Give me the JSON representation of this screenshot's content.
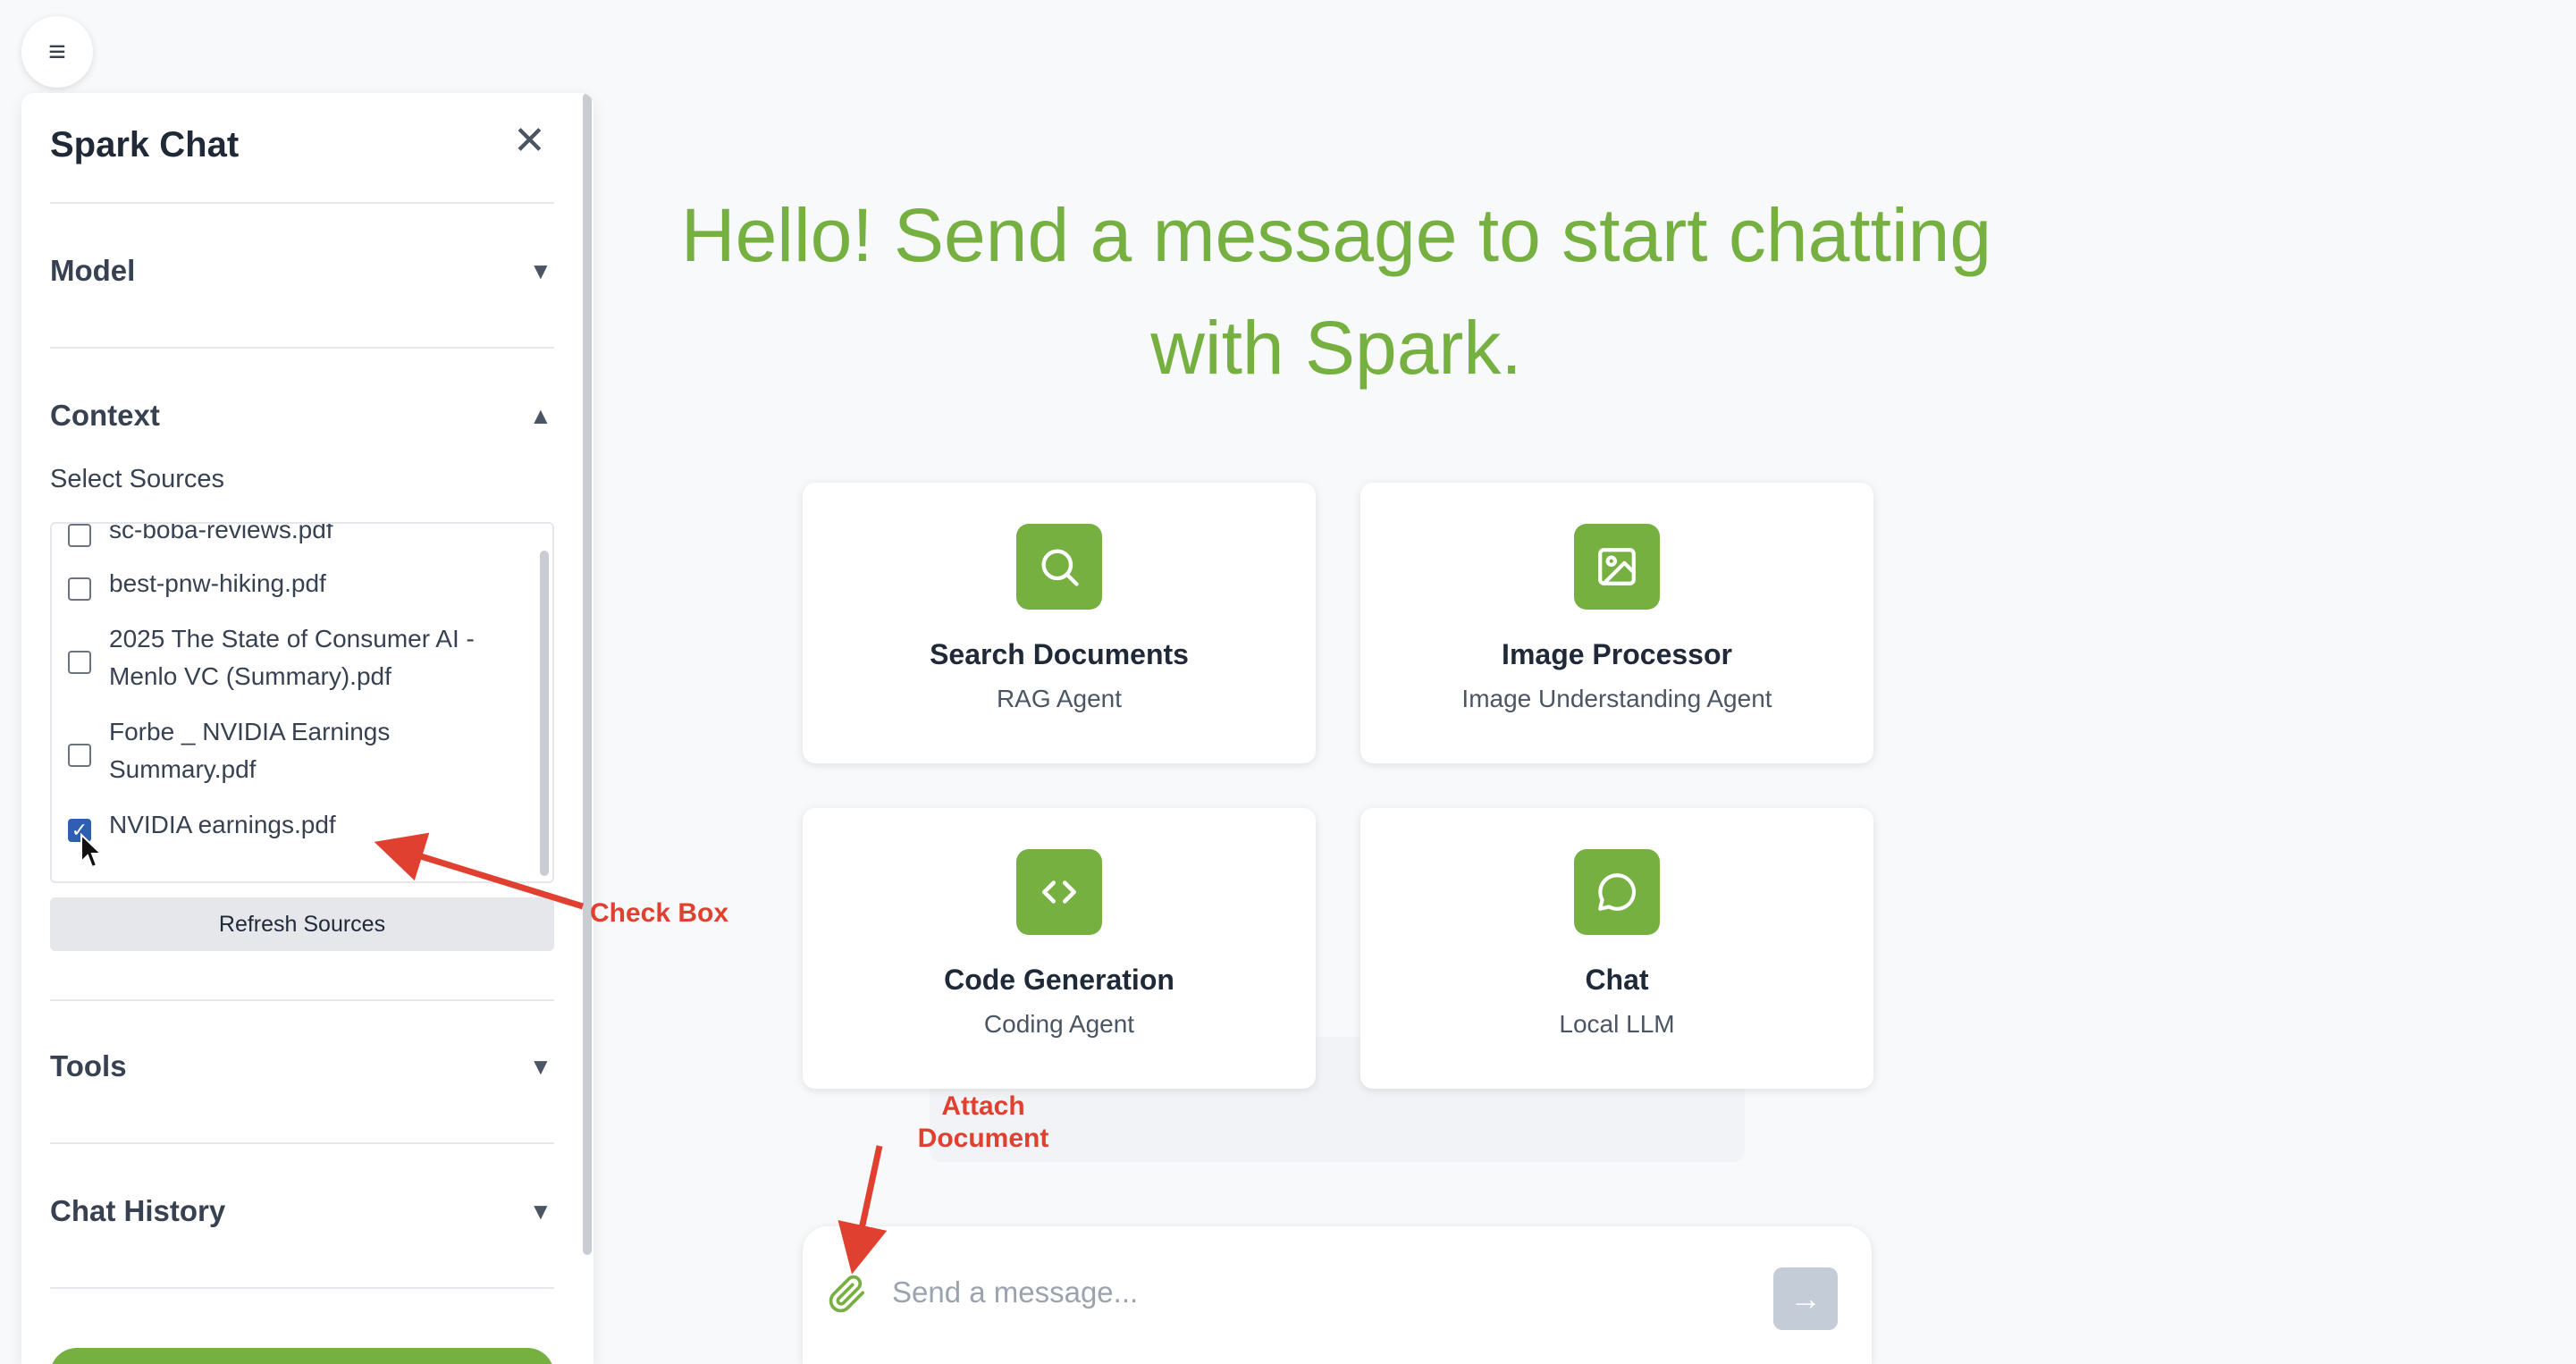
{
  "sidebar": {
    "title": "Spark Chat",
    "close_glyph": "✕",
    "sections": {
      "model": {
        "title": "Model",
        "chevron": "▼"
      },
      "context": {
        "title": "Context",
        "chevron": "▲"
      },
      "tools": {
        "title": "Tools",
        "chevron": "▼"
      },
      "history": {
        "title": "Chat History",
        "chevron": "▼"
      }
    },
    "select_sources_label": "Select Sources",
    "sources": [
      {
        "label": "sc-boba-reviews.pdf",
        "checked": false
      },
      {
        "label": "best-pnw-hiking.pdf",
        "checked": false
      },
      {
        "label": "2025 The State of Consumer AI - Menlo VC (Summary).pdf",
        "checked": false
      },
      {
        "label": "Forbe _ NVIDIA Earnings Summary.pdf",
        "checked": false
      },
      {
        "label": "NVIDIA earnings.pdf",
        "checked": true
      }
    ],
    "refresh_label": "Refresh Sources"
  },
  "hamburger_glyph": "≡",
  "main": {
    "greeting": "Hello! Send a message to start chatting with Spark.",
    "cards": [
      {
        "title": "Search Documents",
        "subtitle": "RAG Agent",
        "icon": "search-icon"
      },
      {
        "title": "Image Processor",
        "subtitle": "Image Understanding Agent",
        "icon": "image-icon"
      },
      {
        "title": "Code Generation",
        "subtitle": "Coding Agent",
        "icon": "code-icon"
      },
      {
        "title": "Chat",
        "subtitle": "Local LLM",
        "icon": "chat-bubble-icon"
      }
    ],
    "input_placeholder": "Send a message...",
    "send_glyph": "→"
  },
  "annotations": {
    "check_box": "Check Box",
    "attach_document": "Attach Document"
  },
  "colors": {
    "accent": "#76b041",
    "annotation": "#e04030"
  }
}
